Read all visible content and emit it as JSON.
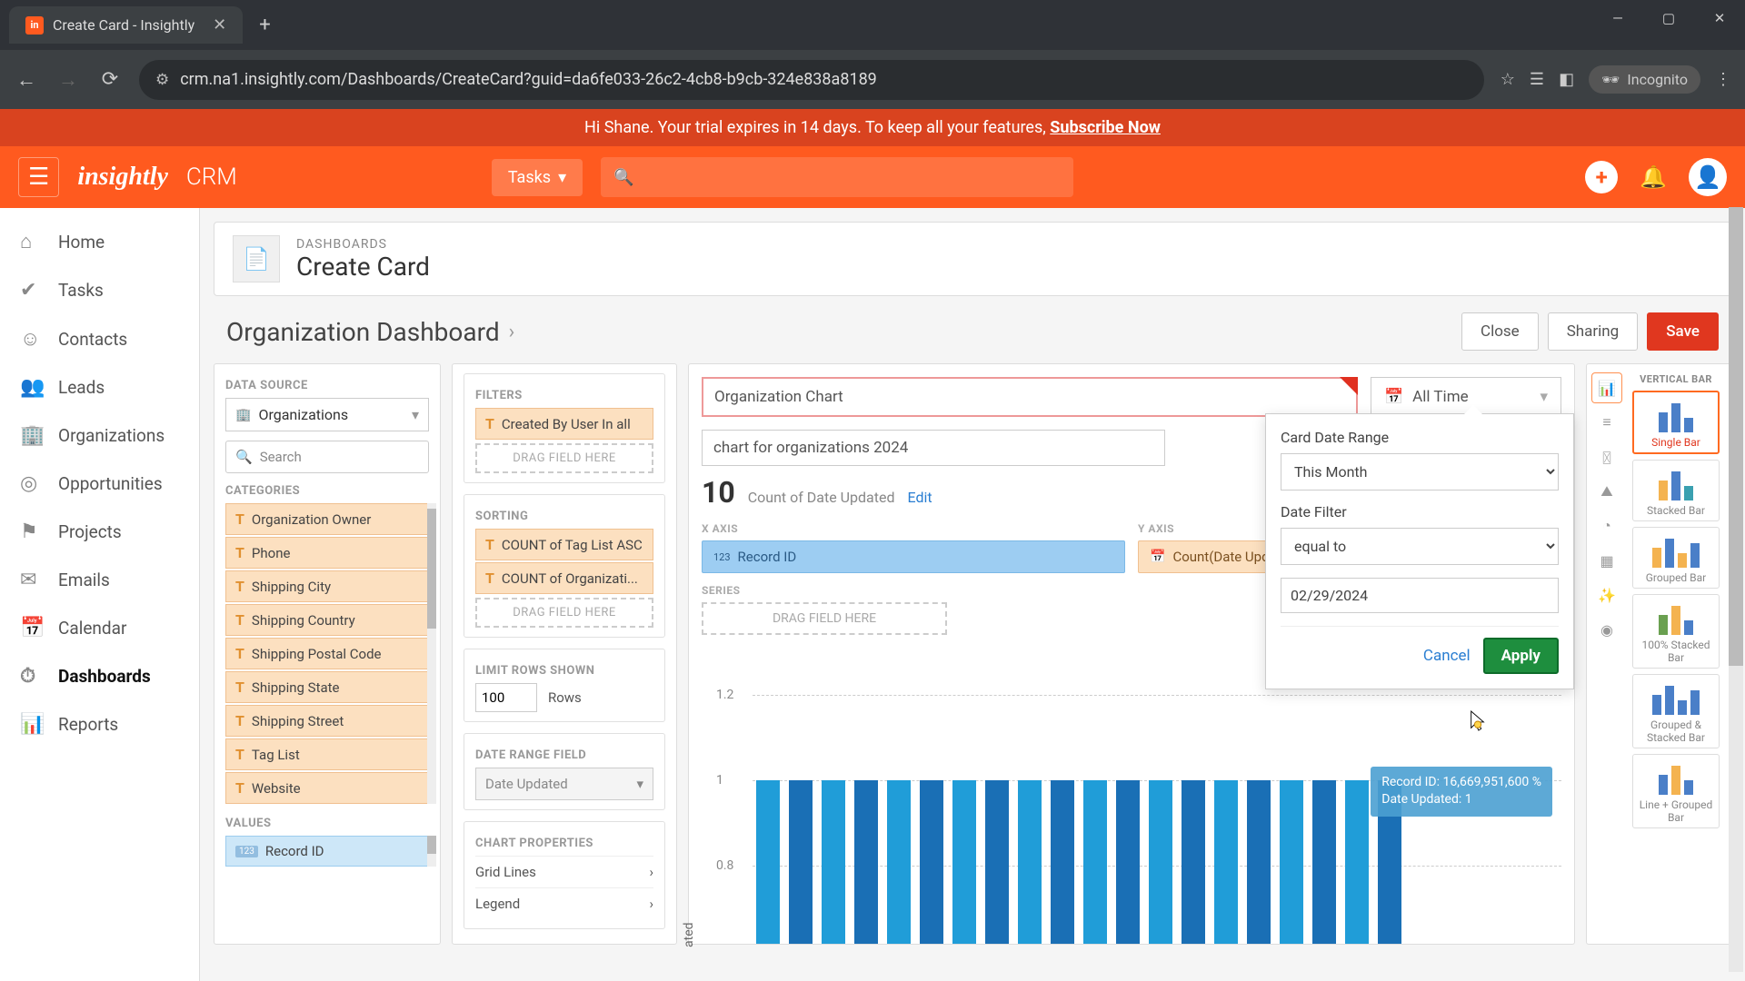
{
  "browser": {
    "tab_title": "Create Card - Insightly",
    "url": "crm.na1.insightly.com/Dashboards/CreateCard?guid=da6fe033-26c2-4cb8-b9cb-324e838a8189",
    "incognito_label": "Incognito"
  },
  "trial_banner": {
    "greeting": "Hi Shane. Your trial expires in 14 days. To keep all your features, ",
    "cta": "Subscribe Now"
  },
  "header": {
    "logo": "insightly",
    "app": "CRM",
    "task_label": "Tasks"
  },
  "sidebar": {
    "items": [
      {
        "icon": "⌂",
        "label": "Home"
      },
      {
        "icon": "✔",
        "label": "Tasks"
      },
      {
        "icon": "☺",
        "label": "Contacts"
      },
      {
        "icon": "👥",
        "label": "Leads"
      },
      {
        "icon": "🏢",
        "label": "Organizations"
      },
      {
        "icon": "◎",
        "label": "Opportunities"
      },
      {
        "icon": "⚑",
        "label": "Projects"
      },
      {
        "icon": "✉",
        "label": "Emails"
      },
      {
        "icon": "📅",
        "label": "Calendar"
      },
      {
        "icon": "⏱",
        "label": "Dashboards"
      },
      {
        "icon": "📊",
        "label": "Reports"
      }
    ],
    "active_index": 9
  },
  "breadcrumb": {
    "small": "DASHBOARDS",
    "big": "Create Card"
  },
  "dash_title": "Organization Dashboard",
  "buttons": {
    "close": "Close",
    "sharing": "Sharing",
    "save": "Save"
  },
  "data_source": {
    "section_label": "DATA SOURCE",
    "selected": "Organizations",
    "search_placeholder": "Search",
    "categories_label": "CATEGORIES",
    "categories": [
      "Organization Owner",
      "Phone",
      "Shipping City",
      "Shipping Country",
      "Shipping Postal Code",
      "Shipping State",
      "Shipping Street",
      "Tag List",
      "Website"
    ],
    "values_label": "VALUES",
    "values": [
      {
        "tag": "123",
        "name": "Record ID"
      }
    ]
  },
  "filters_col": {
    "filters_label": "FILTERS",
    "filter_chip": "Created By User In all",
    "drag_label": "DRAG FIELD HERE",
    "sorting_label": "SORTING",
    "sort1": "COUNT of Tag List ASC",
    "sort2": "COUNT of Organizati...",
    "limit_label": "LIMIT ROWS SHOWN",
    "limit_value": "100",
    "rows_label": "Rows",
    "daterange_label": "DATE RANGE FIELD",
    "daterange_value": "Date Updated",
    "props_label": "CHART PROPERTIES",
    "props": [
      "Grid Lines",
      "Legend"
    ]
  },
  "chart_area": {
    "title": "Organization Chart",
    "time_label": "All Time",
    "subtitle": "chart for organizations 2024",
    "count_value": "10",
    "count_label": "Count of Date Updated",
    "edit_label": "Edit",
    "xaxis_label": "X AXIS",
    "xaxis_field": "Record ID",
    "xaxis_tag": "123",
    "yaxis_label": "Y AXIS",
    "yaxis_field": "Count(Date Updated)",
    "series_label": "SERIES",
    "series_drag": "DRAG FIELD HERE",
    "y_axis_title": "ated",
    "tooltip_line1": "Record ID: 16,669,951,600 %",
    "tooltip_line2": "Date Updated: 1"
  },
  "chart_data": {
    "type": "bar",
    "yticks": [
      "1.2",
      "1",
      "0.8"
    ],
    "values": [
      1,
      1,
      1,
      1,
      1,
      1,
      1,
      1,
      1,
      1,
      1,
      1,
      1,
      1,
      1,
      1,
      1,
      1,
      1,
      1
    ],
    "ylim": [
      0,
      1.2
    ]
  },
  "popover": {
    "title": "Card Date Range",
    "range_value": "This Month",
    "filter_label": "Date Filter",
    "filter_value": "equal to",
    "date_value": "02/29/2024",
    "cancel": "Cancel",
    "apply": "Apply"
  },
  "chart_types": {
    "heading": "VERTICAL BAR",
    "options": [
      {
        "name": "Single Bar",
        "active": true
      },
      {
        "name": "Stacked Bar"
      },
      {
        "name": "Grouped Bar"
      },
      {
        "name": "100% Stacked Bar"
      },
      {
        "name": "Grouped & Stacked Bar"
      },
      {
        "name": "Line + Grouped Bar"
      }
    ]
  }
}
